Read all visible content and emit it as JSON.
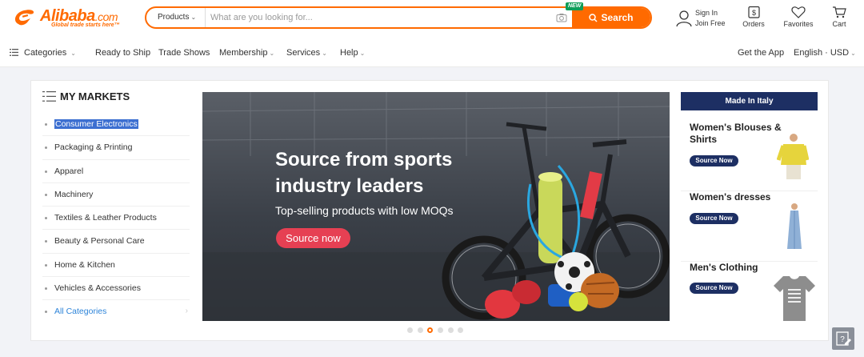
{
  "header": {
    "logo_word": "Alibaba",
    "logo_dotcom": ".com",
    "logo_tagline": "Global trade starts here™",
    "search_category": "Products",
    "search_placeholder": "What are you looking for...",
    "search_button": "Search",
    "new_badge": "NEW",
    "sign_in": "Sign In",
    "join_free": "Join Free",
    "orders": "Orders",
    "favorites": "Favorites",
    "cart": "Cart",
    "brand_color": "#ff6a00"
  },
  "nav": {
    "categories": "Categories",
    "ready_to_ship": "Ready to Ship",
    "trade_shows": "Trade Shows",
    "membership": "Membership",
    "services": "Services",
    "help": "Help",
    "get_app": "Get the App",
    "language_currency": "English · USD"
  },
  "markets": {
    "title": "MY MARKETS",
    "items": [
      {
        "label": "Consumer Electronics",
        "selected": true
      },
      {
        "label": "Packaging & Printing"
      },
      {
        "label": "Apparel"
      },
      {
        "label": "Machinery"
      },
      {
        "label": "Textiles & Leather Products"
      },
      {
        "label": "Beauty & Personal Care"
      },
      {
        "label": "Home & Kitchen"
      },
      {
        "label": "Vehicles & Accessories"
      }
    ],
    "all_categories": "All Categories"
  },
  "banner": {
    "headline": "Source from sports industry leaders",
    "subtitle": "Top-selling products with low MOQs",
    "button": "Source now",
    "slide_count": 6,
    "active_slide": 3
  },
  "italy": {
    "header": "Made In Italy",
    "items": [
      {
        "title": "Women's Blouses & Shirts",
        "button": "Source Now"
      },
      {
        "title": "Women's dresses",
        "button": "Source Now"
      },
      {
        "title": "Men's Clothing",
        "button": "Source Now"
      }
    ],
    "accent_color": "#1d2f63"
  }
}
